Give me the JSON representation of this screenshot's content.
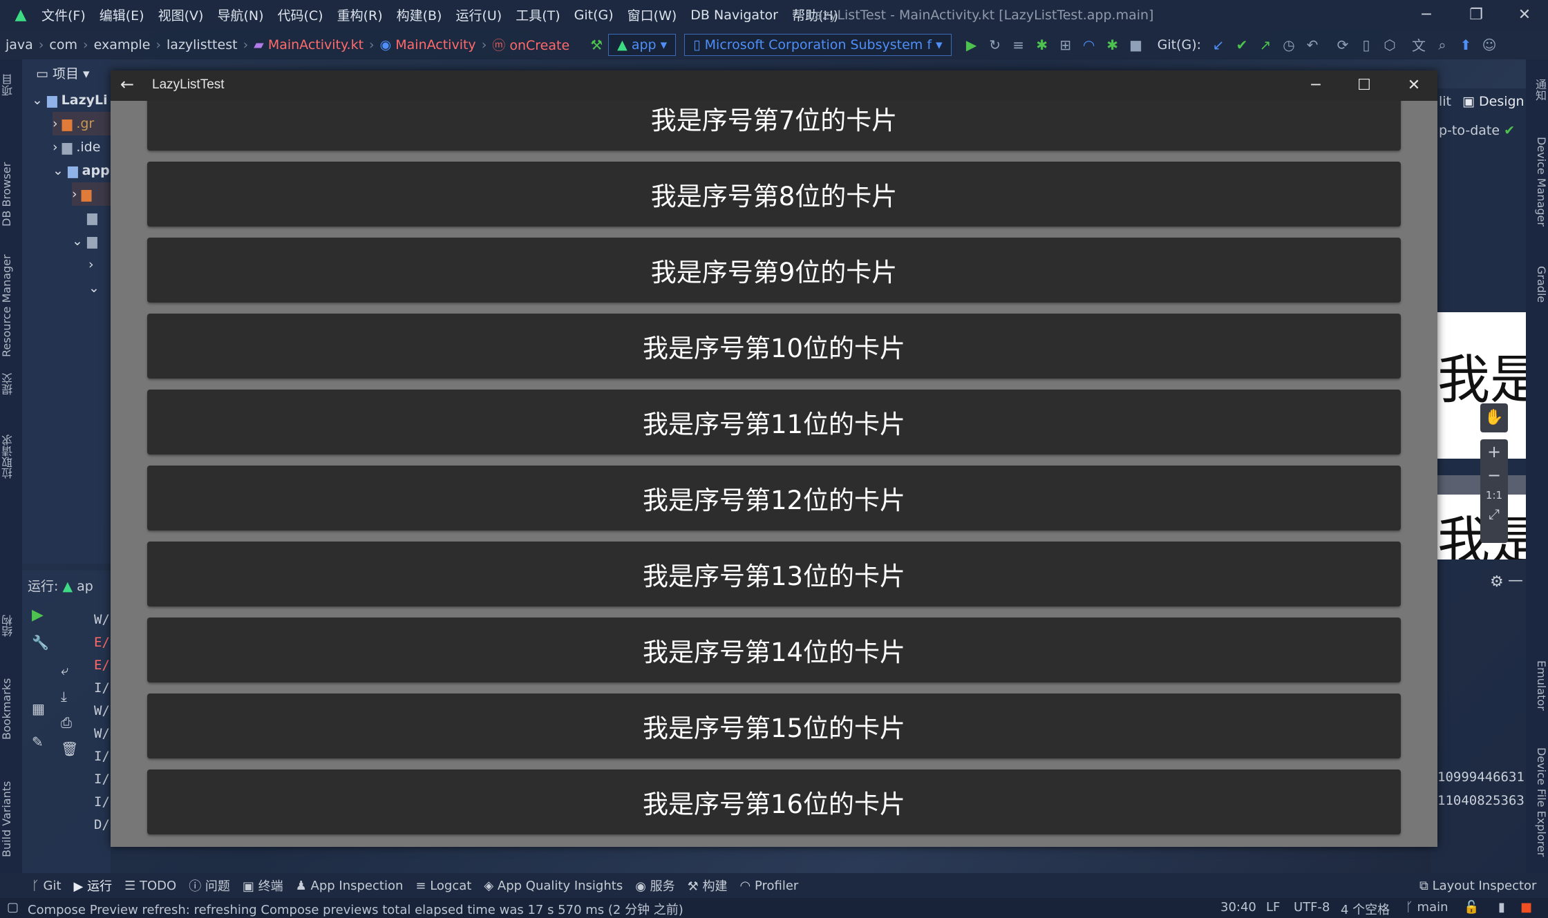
{
  "menubar": {
    "items": [
      "文件(F)",
      "编辑(E)",
      "视图(V)",
      "导航(N)",
      "代码(C)",
      "重构(R)",
      "构建(B)",
      "运行(U)",
      "工具(T)",
      "Git(G)",
      "窗口(W)",
      "DB Navigator",
      "帮助(H)"
    ],
    "window_title": "LazyListTest - MainActivity.kt [LazyListTest.app.main]"
  },
  "navbar": {
    "crumbs": [
      "java",
      "com",
      "example",
      "lazylisttest"
    ],
    "file": "MainActivity.kt",
    "class": "MainActivity",
    "method": "onCreate",
    "run_config": "app",
    "device": "Microsoft Corporation Subsystem f",
    "git_label": "Git(G):"
  },
  "left_tabs": [
    "项目",
    "DB Browser",
    "Resource Manager",
    "提交",
    "拉取请求",
    "结构",
    "Bookmarks",
    "Build Variants"
  ],
  "right_tabs": [
    "通知",
    "Device Manager",
    "Gradle",
    "Emulator",
    "Device File Explorer"
  ],
  "project": {
    "header": "项目",
    "rows": [
      ".gr",
      ".ide",
      "app"
    ],
    "root": "LazyLi"
  },
  "run": {
    "label": "运行:",
    "config": "ap",
    "log_levels": [
      "W/",
      "E/",
      "E/",
      "I/",
      "W/",
      "W/",
      "I/",
      "I/",
      "I/",
      "D/"
    ]
  },
  "editor_right": {
    "split_label": "lit",
    "design_label": "Design",
    "status": "p-to-date",
    "preview_text": "我是",
    "zoom_ratio": "1:1",
    "log_nums": [
      "10999446631",
      "11040825363"
    ]
  },
  "emulator": {
    "title": "LazyListTest",
    "cards": [
      "我是序号第7位的卡片",
      "我是序号第8位的卡片",
      "我是序号第9位的卡片",
      "我是序号第10位的卡片",
      "我是序号第11位的卡片",
      "我是序号第12位的卡片",
      "我是序号第13位的卡片",
      "我是序号第14位的卡片",
      "我是序号第15位的卡片",
      "我是序号第16位的卡片"
    ]
  },
  "toolwindows": {
    "git": "Git",
    "run": "运行",
    "todo": "TODO",
    "problems": "问题",
    "terminal": "终端",
    "app_inspection": "App Inspection",
    "logcat": "Logcat",
    "aqi": "App Quality Insights",
    "services": "服务",
    "build": "构建",
    "profiler": "Profiler",
    "layout_inspector": "Layout Inspector"
  },
  "status": {
    "message": "Compose Preview refresh: refreshing Compose previews total elapsed time was 17 s 570 ms (2 分钟 之前)",
    "position": "30:40",
    "line_sep": "LF",
    "encoding": "UTF-8",
    "indent": "4 个空格",
    "branch": "main"
  },
  "colors": {
    "accent": "#3ddc84",
    "error": "#ff6b6b",
    "link": "#4f8ff7",
    "card": "#2d2d2d",
    "emulator_bg": "#777777"
  }
}
